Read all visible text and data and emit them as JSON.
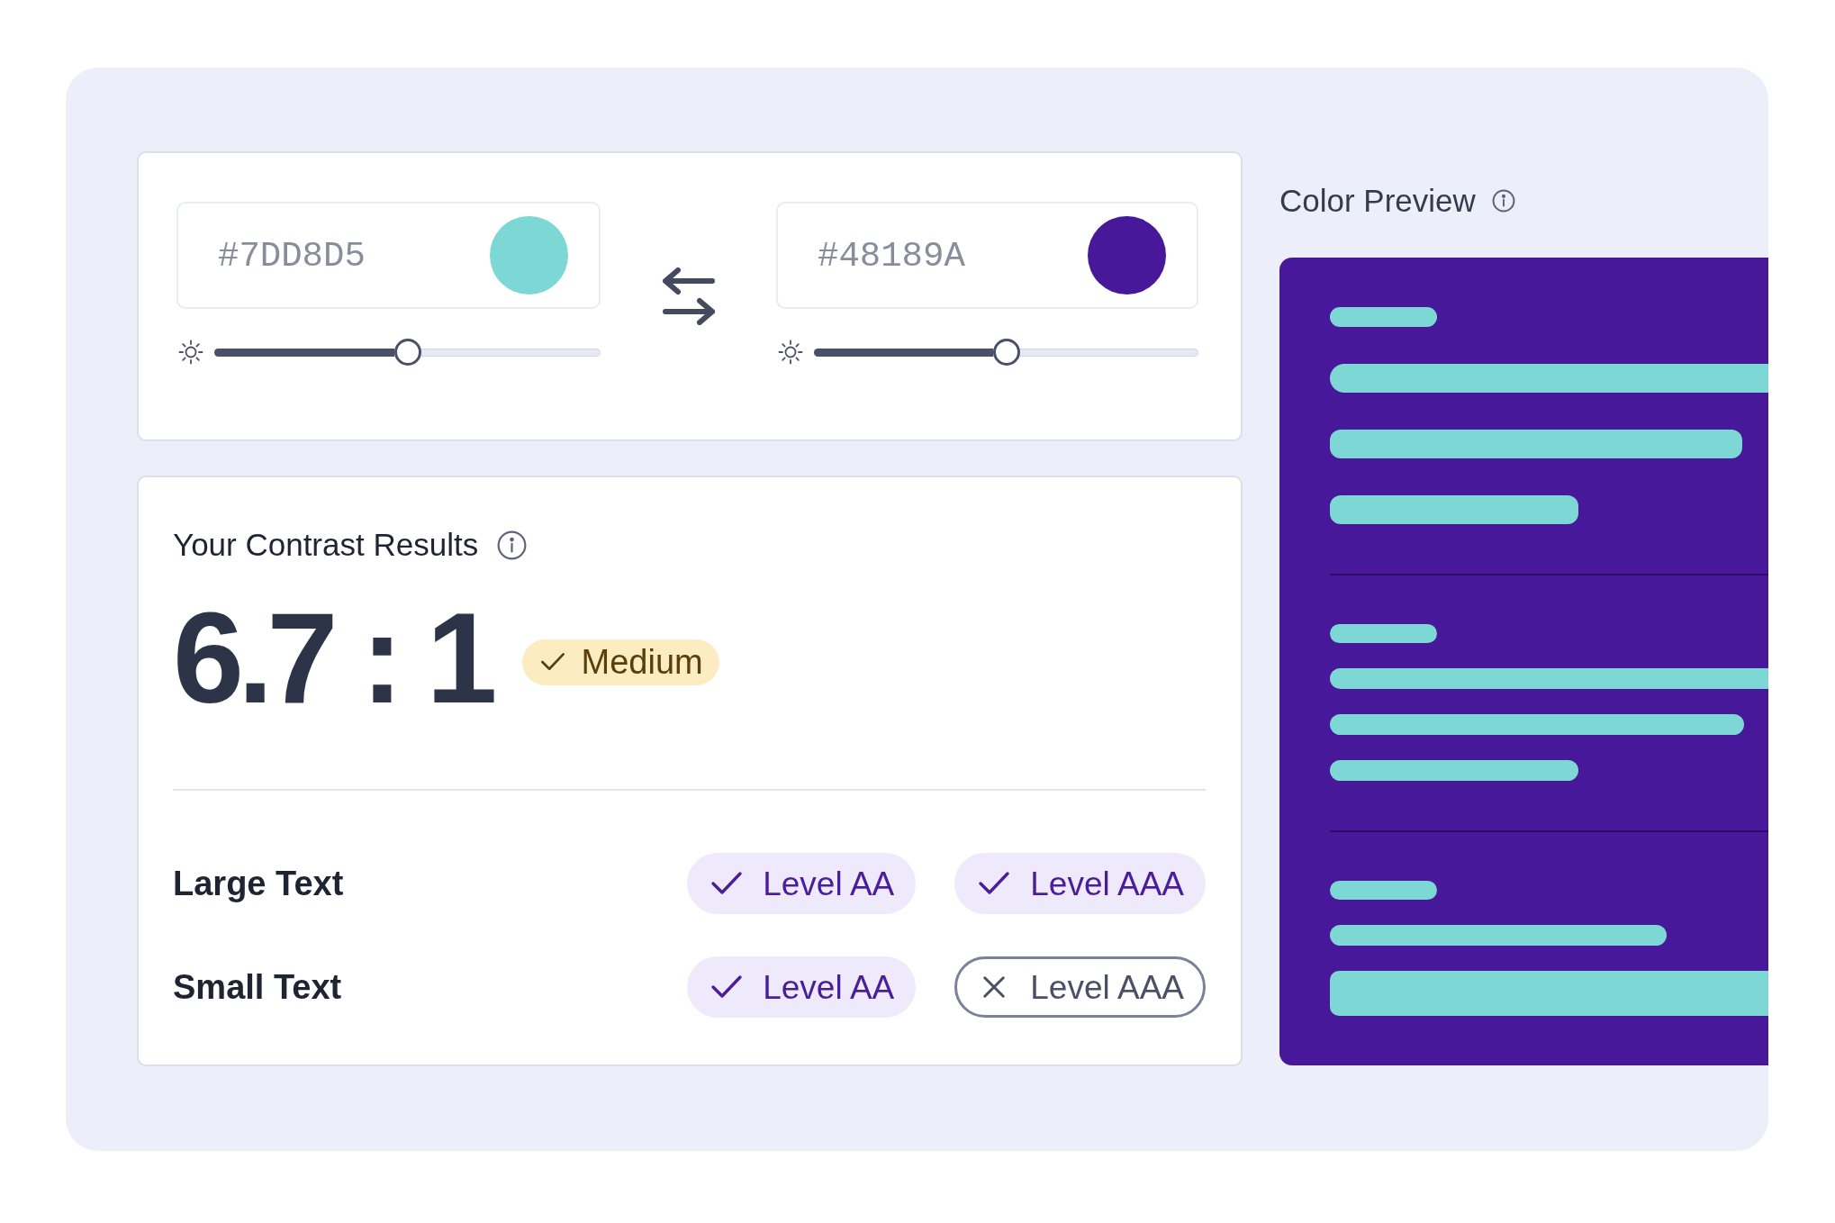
{
  "colors": [
    {
      "hex": "#7DD8D5",
      "color": "#7dd8d5",
      "level": 0.5
    },
    {
      "hex": "#48189A",
      "color": "#48189a",
      "level": 0.5
    }
  ],
  "results": {
    "title": "Your Contrast Results",
    "ratio": "6.7 : 1",
    "rating": {
      "label": "Medium",
      "kind": "medium"
    },
    "rows": [
      {
        "label": "Large Text",
        "levels": [
          {
            "label": "Level AA",
            "passed": true
          },
          {
            "label": "Level AAA",
            "passed": true
          }
        ]
      },
      {
        "label": "Small Text",
        "levels": [
          {
            "label": "Level AA",
            "passed": true
          },
          {
            "label": "Level AAA",
            "passed": false
          }
        ]
      }
    ]
  },
  "preview": {
    "title": "Color Preview"
  }
}
